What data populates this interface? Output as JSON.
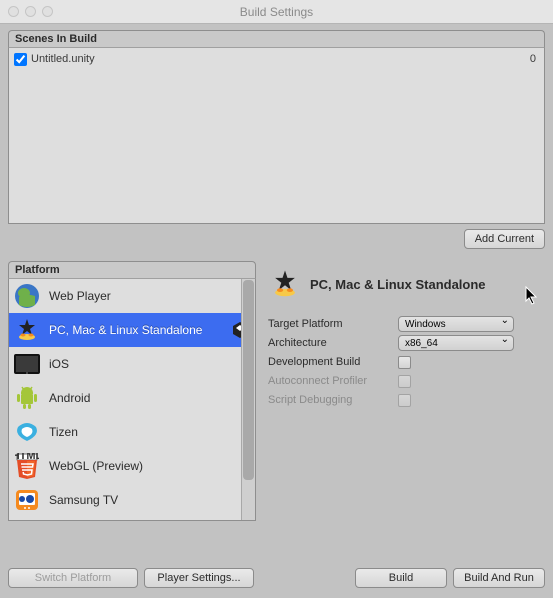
{
  "window": {
    "title": "Build Settings"
  },
  "scenes": {
    "header": "Scenes In Build",
    "items": [
      {
        "checked": true,
        "name": "Untitled.unity",
        "index": "0"
      }
    ],
    "add_button": "Add Current"
  },
  "platform": {
    "header": "Platform",
    "items": [
      {
        "id": "web",
        "label": "Web Player",
        "selected": false
      },
      {
        "id": "standalone",
        "label": "PC, Mac & Linux Standalone",
        "selected": true
      },
      {
        "id": "ios",
        "label": "iOS",
        "selected": false
      },
      {
        "id": "android",
        "label": "Android",
        "selected": false
      },
      {
        "id": "tizen",
        "label": "Tizen",
        "selected": false
      },
      {
        "id": "webgl",
        "label": "WebGL (Preview)",
        "selected": false
      },
      {
        "id": "samsungtv",
        "label": "Samsung TV",
        "selected": false
      }
    ]
  },
  "current_platform": {
    "title": "PC, Mac & Linux Standalone",
    "options": {
      "target_platform": {
        "label": "Target Platform",
        "value": "Windows"
      },
      "architecture": {
        "label": "Architecture",
        "value": "x86_64"
      },
      "development_build": {
        "label": "Development Build",
        "checked": false
      },
      "autoconnect_profiler": {
        "label": "Autoconnect Profiler",
        "checked": false,
        "disabled": true
      },
      "script_debugging": {
        "label": "Script Debugging",
        "checked": false,
        "disabled": true
      }
    }
  },
  "buttons": {
    "switch_platform": "Switch Platform",
    "player_settings": "Player Settings...",
    "build": "Build",
    "build_and_run": "Build And Run"
  }
}
